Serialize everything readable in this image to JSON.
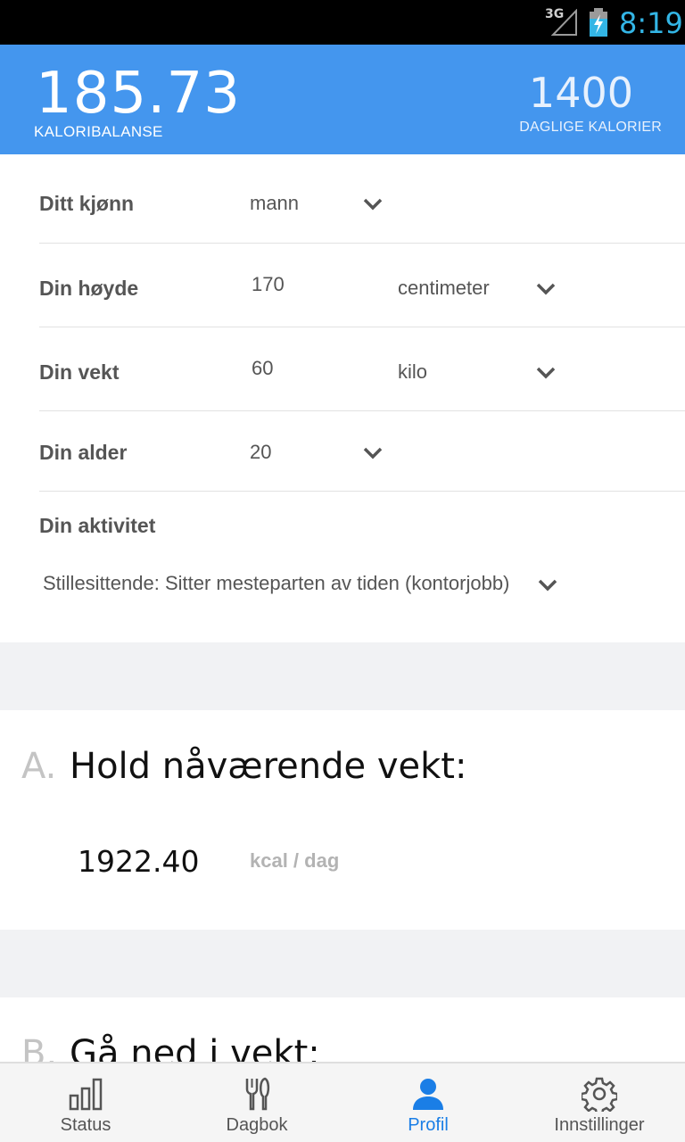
{
  "statusbar": {
    "network": "3G",
    "time": "8:19"
  },
  "header": {
    "balance_value": "185.73",
    "balance_label": "KALORIBALANSE",
    "daily_value": "1400",
    "daily_label": "DAGLIGE KALORIER",
    "color": "#4496ee"
  },
  "form": {
    "gender": {
      "label": "Ditt kjønn",
      "value": "mann"
    },
    "height": {
      "label": "Din høyde",
      "value": "170",
      "unit": "centimeter"
    },
    "weight": {
      "label": "Din vekt",
      "value": "60",
      "unit": "kilo"
    },
    "age": {
      "label": "Din alder",
      "value": "20"
    },
    "activity": {
      "label": "Din aktivitet",
      "value": "Stillesittende: Sitter mesteparten av tiden (kontorjobb)"
    }
  },
  "cards": {
    "a": {
      "letter": "A.",
      "title": "Hold nåværende vekt:",
      "number": "1922.40",
      "unit": "kcal / dag"
    },
    "b": {
      "letter": "B.",
      "title": "Gå ned i vekt:"
    }
  },
  "nav": {
    "items": [
      {
        "label": "Status",
        "icon": "bar-chart-icon"
      },
      {
        "label": "Dagbok",
        "icon": "cutlery-icon"
      },
      {
        "label": "Profil",
        "icon": "person-icon",
        "active": true
      },
      {
        "label": "Innstillinger",
        "icon": "gear-icon"
      }
    ],
    "active_color": "#1a7ee6"
  }
}
